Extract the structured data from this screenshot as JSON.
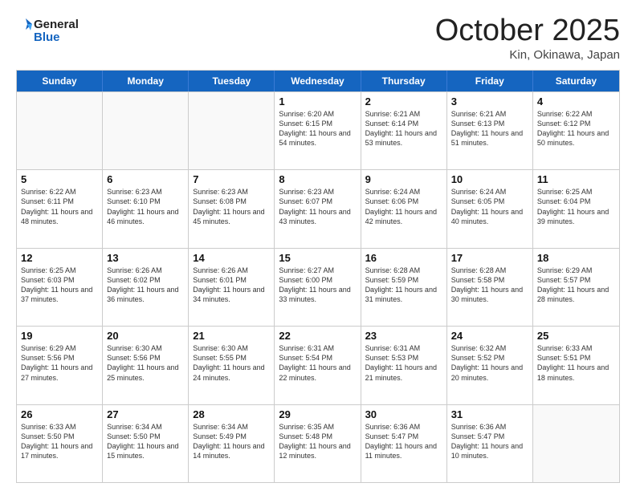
{
  "header": {
    "logo_line1": "General",
    "logo_line2": "Blue",
    "month": "October 2025",
    "location": "Kin, Okinawa, Japan"
  },
  "days_of_week": [
    "Sunday",
    "Monday",
    "Tuesday",
    "Wednesday",
    "Thursday",
    "Friday",
    "Saturday"
  ],
  "weeks": [
    [
      {
        "day": "",
        "info": ""
      },
      {
        "day": "",
        "info": ""
      },
      {
        "day": "",
        "info": ""
      },
      {
        "day": "1",
        "info": "Sunrise: 6:20 AM\nSunset: 6:15 PM\nDaylight: 11 hours\nand 54 minutes."
      },
      {
        "day": "2",
        "info": "Sunrise: 6:21 AM\nSunset: 6:14 PM\nDaylight: 11 hours\nand 53 minutes."
      },
      {
        "day": "3",
        "info": "Sunrise: 6:21 AM\nSunset: 6:13 PM\nDaylight: 11 hours\nand 51 minutes."
      },
      {
        "day": "4",
        "info": "Sunrise: 6:22 AM\nSunset: 6:12 PM\nDaylight: 11 hours\nand 50 minutes."
      }
    ],
    [
      {
        "day": "5",
        "info": "Sunrise: 6:22 AM\nSunset: 6:11 PM\nDaylight: 11 hours\nand 48 minutes."
      },
      {
        "day": "6",
        "info": "Sunrise: 6:23 AM\nSunset: 6:10 PM\nDaylight: 11 hours\nand 46 minutes."
      },
      {
        "day": "7",
        "info": "Sunrise: 6:23 AM\nSunset: 6:08 PM\nDaylight: 11 hours\nand 45 minutes."
      },
      {
        "day": "8",
        "info": "Sunrise: 6:23 AM\nSunset: 6:07 PM\nDaylight: 11 hours\nand 43 minutes."
      },
      {
        "day": "9",
        "info": "Sunrise: 6:24 AM\nSunset: 6:06 PM\nDaylight: 11 hours\nand 42 minutes."
      },
      {
        "day": "10",
        "info": "Sunrise: 6:24 AM\nSunset: 6:05 PM\nDaylight: 11 hours\nand 40 minutes."
      },
      {
        "day": "11",
        "info": "Sunrise: 6:25 AM\nSunset: 6:04 PM\nDaylight: 11 hours\nand 39 minutes."
      }
    ],
    [
      {
        "day": "12",
        "info": "Sunrise: 6:25 AM\nSunset: 6:03 PM\nDaylight: 11 hours\nand 37 minutes."
      },
      {
        "day": "13",
        "info": "Sunrise: 6:26 AM\nSunset: 6:02 PM\nDaylight: 11 hours\nand 36 minutes."
      },
      {
        "day": "14",
        "info": "Sunrise: 6:26 AM\nSunset: 6:01 PM\nDaylight: 11 hours\nand 34 minutes."
      },
      {
        "day": "15",
        "info": "Sunrise: 6:27 AM\nSunset: 6:00 PM\nDaylight: 11 hours\nand 33 minutes."
      },
      {
        "day": "16",
        "info": "Sunrise: 6:28 AM\nSunset: 5:59 PM\nDaylight: 11 hours\nand 31 minutes."
      },
      {
        "day": "17",
        "info": "Sunrise: 6:28 AM\nSunset: 5:58 PM\nDaylight: 11 hours\nand 30 minutes."
      },
      {
        "day": "18",
        "info": "Sunrise: 6:29 AM\nSunset: 5:57 PM\nDaylight: 11 hours\nand 28 minutes."
      }
    ],
    [
      {
        "day": "19",
        "info": "Sunrise: 6:29 AM\nSunset: 5:56 PM\nDaylight: 11 hours\nand 27 minutes."
      },
      {
        "day": "20",
        "info": "Sunrise: 6:30 AM\nSunset: 5:56 PM\nDaylight: 11 hours\nand 25 minutes."
      },
      {
        "day": "21",
        "info": "Sunrise: 6:30 AM\nSunset: 5:55 PM\nDaylight: 11 hours\nand 24 minutes."
      },
      {
        "day": "22",
        "info": "Sunrise: 6:31 AM\nSunset: 5:54 PM\nDaylight: 11 hours\nand 22 minutes."
      },
      {
        "day": "23",
        "info": "Sunrise: 6:31 AM\nSunset: 5:53 PM\nDaylight: 11 hours\nand 21 minutes."
      },
      {
        "day": "24",
        "info": "Sunrise: 6:32 AM\nSunset: 5:52 PM\nDaylight: 11 hours\nand 20 minutes."
      },
      {
        "day": "25",
        "info": "Sunrise: 6:33 AM\nSunset: 5:51 PM\nDaylight: 11 hours\nand 18 minutes."
      }
    ],
    [
      {
        "day": "26",
        "info": "Sunrise: 6:33 AM\nSunset: 5:50 PM\nDaylight: 11 hours\nand 17 minutes."
      },
      {
        "day": "27",
        "info": "Sunrise: 6:34 AM\nSunset: 5:50 PM\nDaylight: 11 hours\nand 15 minutes."
      },
      {
        "day": "28",
        "info": "Sunrise: 6:34 AM\nSunset: 5:49 PM\nDaylight: 11 hours\nand 14 minutes."
      },
      {
        "day": "29",
        "info": "Sunrise: 6:35 AM\nSunset: 5:48 PM\nDaylight: 11 hours\nand 12 minutes."
      },
      {
        "day": "30",
        "info": "Sunrise: 6:36 AM\nSunset: 5:47 PM\nDaylight: 11 hours\nand 11 minutes."
      },
      {
        "day": "31",
        "info": "Sunrise: 6:36 AM\nSunset: 5:47 PM\nDaylight: 11 hours\nand 10 minutes."
      },
      {
        "day": "",
        "info": ""
      }
    ]
  ]
}
